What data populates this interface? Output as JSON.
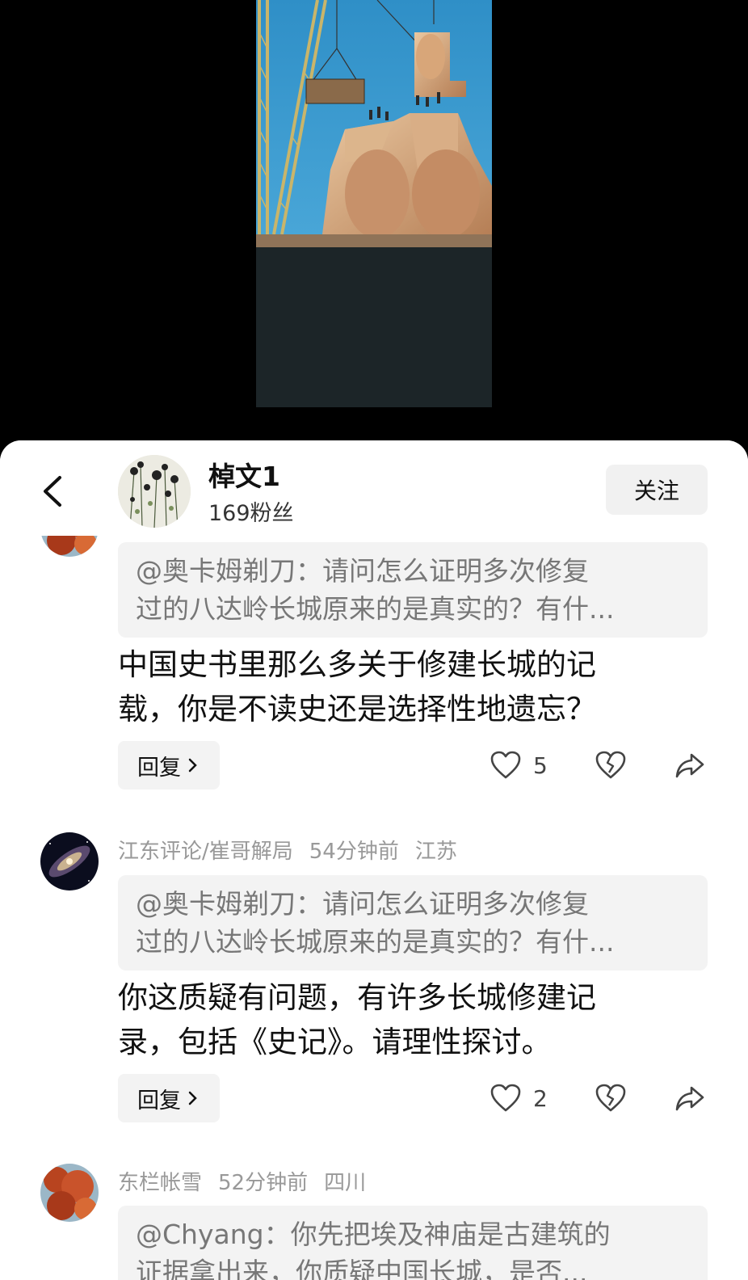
{
  "author": {
    "name": "棹文1",
    "fans": "169粉丝",
    "follow_label": "关注"
  },
  "comments": [
    {
      "quote_line1": "@奥卡姆剃刀：请问怎么证明多次修复",
      "quote_line2": "过的八达岭长城原来的是真实的？有什...",
      "body_line1": "中国史书里那么多关于修建长城的记",
      "body_line2": "载，你是不读史还是选择性地遗忘？",
      "reply_label": "回复",
      "likes": "5"
    },
    {
      "username": "江东评论/崔哥解局",
      "time": "54分钟前",
      "location": "江苏",
      "quote_line1": "@奥卡姆剃刀：请问怎么证明多次修复",
      "quote_line2": "过的八达岭长城原来的是真实的？有什...",
      "body_line1": "你这质疑有问题，有许多长城修建记",
      "body_line2": "录，包括《史记》。请理性探讨。",
      "reply_label": "回复",
      "likes": "2"
    },
    {
      "username": "东栏帐雪",
      "time": "52分钟前",
      "location": "四川",
      "quote_line1": "@Chyang：你先把埃及神庙是古建筑的",
      "quote_line2": "证据拿出来，你质疑中国长城，是否..."
    }
  ],
  "icons": {
    "back": "chevron-left-icon",
    "like": "heart-icon",
    "dislike": "broken-heart-icon",
    "share": "share-icon",
    "reply_arrow": "chevron-right-icon"
  }
}
